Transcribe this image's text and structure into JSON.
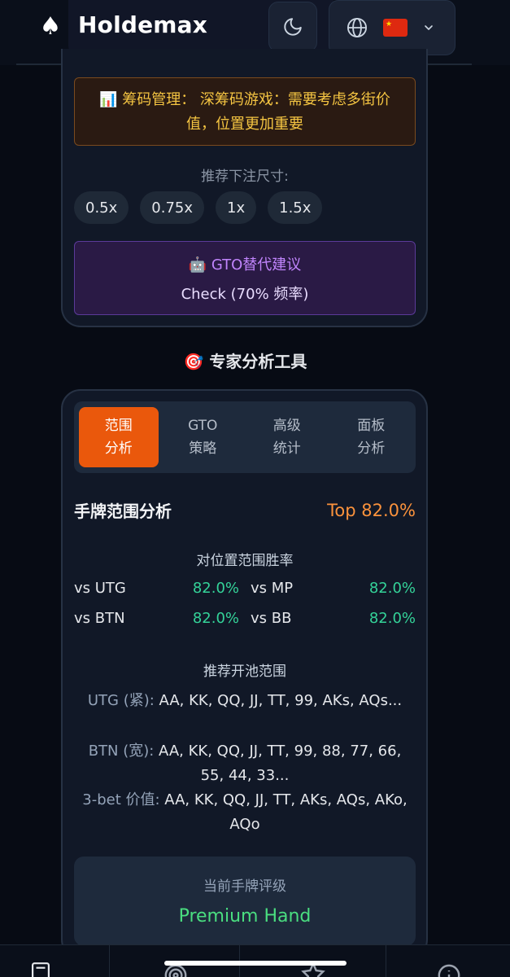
{
  "header": {
    "app_name": "Holdemax",
    "logo_icon": "spade-icon",
    "theme_icon": "moon-icon",
    "language_icon": "globe-icon",
    "language_flag": "china-flag-icon",
    "dropdown_icon": "chevron-down-icon"
  },
  "strategy": {
    "chip_note": "📊 筹码管理： 深筹码游戏：需要考虑多街价值，位置更加重要",
    "bet_label": "推荐下注尺寸:",
    "bet_sizes": [
      "0.5x",
      "0.75x",
      "1x",
      "1.5x"
    ],
    "gto_alt_title": "🤖 GTO替代建议",
    "gto_alt_value": "Check (70% 频率)"
  },
  "expert": {
    "title": "🎯 专家分析工具",
    "tabs": [
      {
        "label": "范围\n分析",
        "active": true
      },
      {
        "label": "GTO\n策略",
        "active": false
      },
      {
        "label": "高级\n统计",
        "active": false
      },
      {
        "label": "面板\n分析",
        "active": false
      }
    ],
    "range_title": "手牌范围分析",
    "top_pct": "Top 82.0%",
    "winrate_title": "对位置范围胜率",
    "winrates": [
      {
        "label": "vs UTG",
        "value": "82.0%"
      },
      {
        "label": "vs MP",
        "value": "82.0%"
      },
      {
        "label": "vs BTN",
        "value": "82.0%"
      },
      {
        "label": "vs BB",
        "value": "82.0%"
      }
    ],
    "open_title": "推荐开池范围",
    "open_ranges": [
      {
        "pos": "UTG (紧):",
        "hands": " AA, KK, QQ, JJ, TT, 99, AKs, AQs..."
      },
      {
        "pos": "BTN (宽):",
        "hands": " AA, KK, QQ, JJ, TT, 99, 88, 77, 66, 55, 44, 33..."
      },
      {
        "pos": "3-bet 价值:",
        "hands": " AA, KK, QQ, JJ, TT, AKs, AQs, AKo, AQo"
      }
    ],
    "rating_label": "当前手牌评级",
    "rating_value": "Premium Hand"
  },
  "nav": {
    "icons": [
      "calculator-icon",
      "target-icon",
      "star-icon",
      "info-icon"
    ]
  },
  "colors": {
    "accent_orange": "#ea580c",
    "win_green": "#34d399",
    "premium_green": "#4ade80",
    "gto_purple": "#c084fc",
    "chip_gold": "#f5c542"
  }
}
